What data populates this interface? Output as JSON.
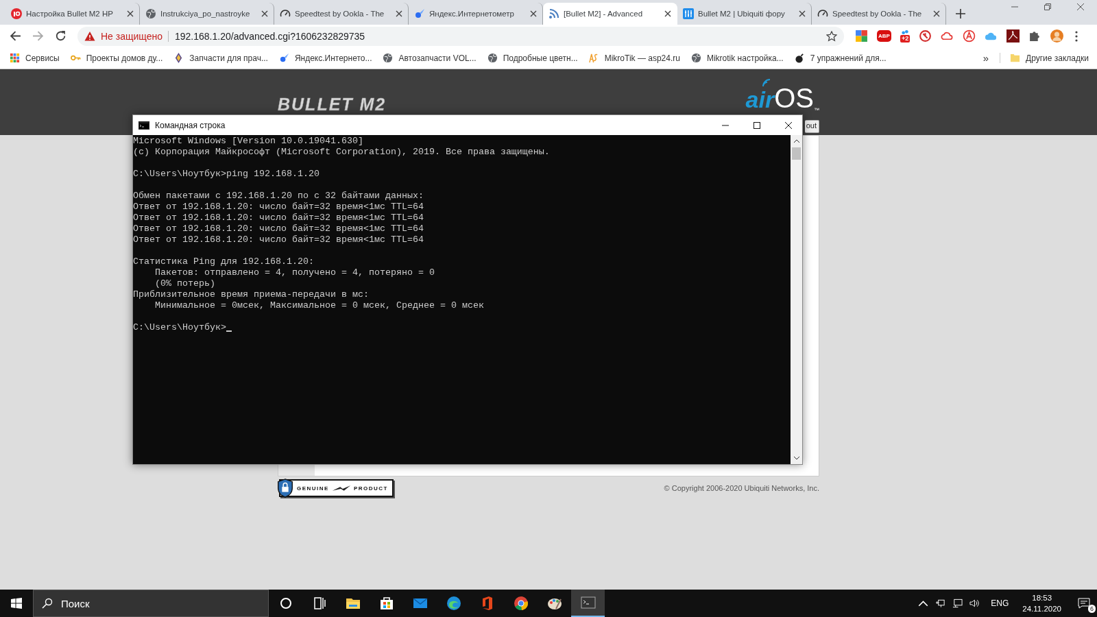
{
  "browser": {
    "tabs": [
      {
        "title": "Настройка Bullet M2 HP",
        "kind": "ip",
        "selected": false
      },
      {
        "title": "Instrukciya_po_nastroyke",
        "kind": "globe",
        "selected": false
      },
      {
        "title": "Speedtest by Ookla - The",
        "kind": "gauge",
        "selected": false
      },
      {
        "title": "Яндекс.Интернетометр",
        "kind": "comet",
        "selected": false
      },
      {
        "title": "[Bullet M2] - Advanced",
        "kind": "rss",
        "selected": true
      },
      {
        "title": "Bullet M2 | Ubiquiti фору",
        "kind": "forum",
        "selected": false
      },
      {
        "title": "Speedtest by Ookla - The",
        "kind": "gauge",
        "selected": false
      }
    ],
    "address": {
      "security": "Не защищено",
      "url": "192.168.1.20/advanced.cgi?1606232829735"
    },
    "extensions": [
      {
        "kind": "squares"
      },
      {
        "kind": "abp",
        "label": "ABP"
      },
      {
        "kind": "drops",
        "badge": "+2"
      },
      {
        "kind": "ring"
      },
      {
        "kind": "cloud"
      },
      {
        "kind": "circle-a"
      },
      {
        "kind": "bluecloud"
      },
      {
        "kind": "pdf"
      },
      {
        "kind": "puzzle"
      },
      {
        "kind": "avatar"
      }
    ],
    "bookmarks": [
      {
        "title": "Сервисы",
        "kind": "apps"
      },
      {
        "title": "Проекты домов ду...",
        "kind": "key"
      },
      {
        "title": "Запчасти для прач...",
        "kind": "diamond"
      },
      {
        "title": "Яндекс.Интернето...",
        "kind": "comet"
      },
      {
        "title": "Автозапчасти VOL...",
        "kind": "globe"
      },
      {
        "title": "Подробные цветн...",
        "kind": "globe"
      },
      {
        "title": "MikroTik — asp24.ru",
        "kind": "asp"
      },
      {
        "title": "Mikrotik настройка...",
        "kind": "globe"
      },
      {
        "title": "7 упражнений для...",
        "kind": "bomb"
      }
    ],
    "more": "»",
    "other_bookmarks": "Другие закладки"
  },
  "page": {
    "product_logo": "BULLET M2",
    "os_logo": {
      "prefix": "air",
      "name": "OS",
      "mark": "™"
    },
    "logout_fragment": "out",
    "badge": {
      "left": "GENUINE",
      "right": "PRODUCT"
    },
    "copyright": "© Copyright 2006-2020 Ubiquiti Networks, Inc."
  },
  "console": {
    "title": "Командная строка",
    "blocks": [
      [
        "Microsoft Windows [Version 10.0.19041.630]",
        "(c) Корпорация Майкрософт (Microsoft Corporation), 2019. Все права защищены."
      ],
      [
        "C:\\Users\\Ноутбук>ping 192.168.1.20"
      ],
      [
        "Обмен пакетами с 192.168.1.20 по с 32 байтами данных:",
        "Ответ от 192.168.1.20: число байт=32 время<1мс TTL=64",
        "Ответ от 192.168.1.20: число байт=32 время<1мс TTL=64",
        "Ответ от 192.168.1.20: число байт=32 время<1мс TTL=64",
        "Ответ от 192.168.1.20: число байт=32 время<1мс TTL=64"
      ],
      [
        "Статистика Ping для 192.168.1.20:",
        "    Пакетов: отправлено = 4, получено = 4, потеряно = 0",
        "    (0% потерь)",
        "Приблизительное время приема-передачи в мс:",
        "    Минимальное = 0мсек, Максимальное = 0 мсек, Среднее = 0 мсек"
      ],
      [
        "C:\\Users\\Ноутбук>"
      ]
    ]
  },
  "taskbar": {
    "search_placeholder": "Поиск",
    "apps": [
      {
        "kind": "cortana",
        "selected": false
      },
      {
        "kind": "taskview",
        "selected": false
      },
      {
        "kind": "explorer",
        "selected": false
      },
      {
        "kind": "store",
        "selected": false
      },
      {
        "kind": "mail",
        "selected": false
      },
      {
        "kind": "edge",
        "selected": false
      },
      {
        "kind": "office",
        "selected": false
      },
      {
        "kind": "chrome",
        "selected": false
      },
      {
        "kind": "paint",
        "selected": false
      },
      {
        "kind": "console",
        "selected": true
      }
    ],
    "language": "ENG",
    "time": "18:53",
    "date": "24.11.2020",
    "notifications": "6"
  }
}
